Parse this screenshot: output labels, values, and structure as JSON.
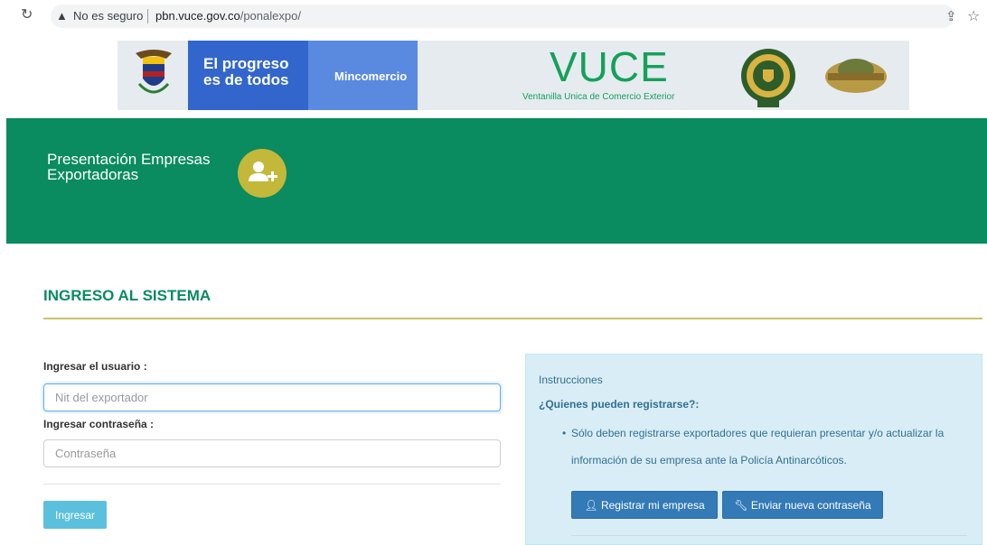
{
  "browser": {
    "security_label": "No es seguro",
    "url_domain": "pbn.vuce.gov.co",
    "url_path": "/ponalexpo/"
  },
  "banner": {
    "progress_text_line1": "El progreso",
    "progress_text_line2": "es de todos",
    "mincomercio": "Mincomercio",
    "vuce_title": "VUCE",
    "vuce_subtitle": "Ventanilla Unica de Comercio Exterior"
  },
  "header": {
    "title_line1": "Presentación Empresas",
    "title_line2": "Exportadoras"
  },
  "section": {
    "title": "INGRESO AL SISTEMA"
  },
  "form": {
    "user_label": "Ingresar el usuario :",
    "user_placeholder": "Nit del exportador",
    "password_label": "Ingresar contraseña :",
    "password_placeholder": "Contraseña",
    "submit_label": "Ingresar"
  },
  "instructions": {
    "heading": "Instrucciones",
    "question": "¿Quienes pueden registrarse?:",
    "item": "Sólo deben registrarse exportadores que requieran presentar y/o actualizar la información de su empresa ante la Policía Antinarcóticos.",
    "register_label": "Registrar mi empresa",
    "reset_label": "Enviar nueva contraseña"
  },
  "colors": {
    "green": "#0a8b60",
    "accent_gold": "#c3b83a",
    "primary_blue": "#337ab7",
    "info_blue": "#5bc0de"
  }
}
